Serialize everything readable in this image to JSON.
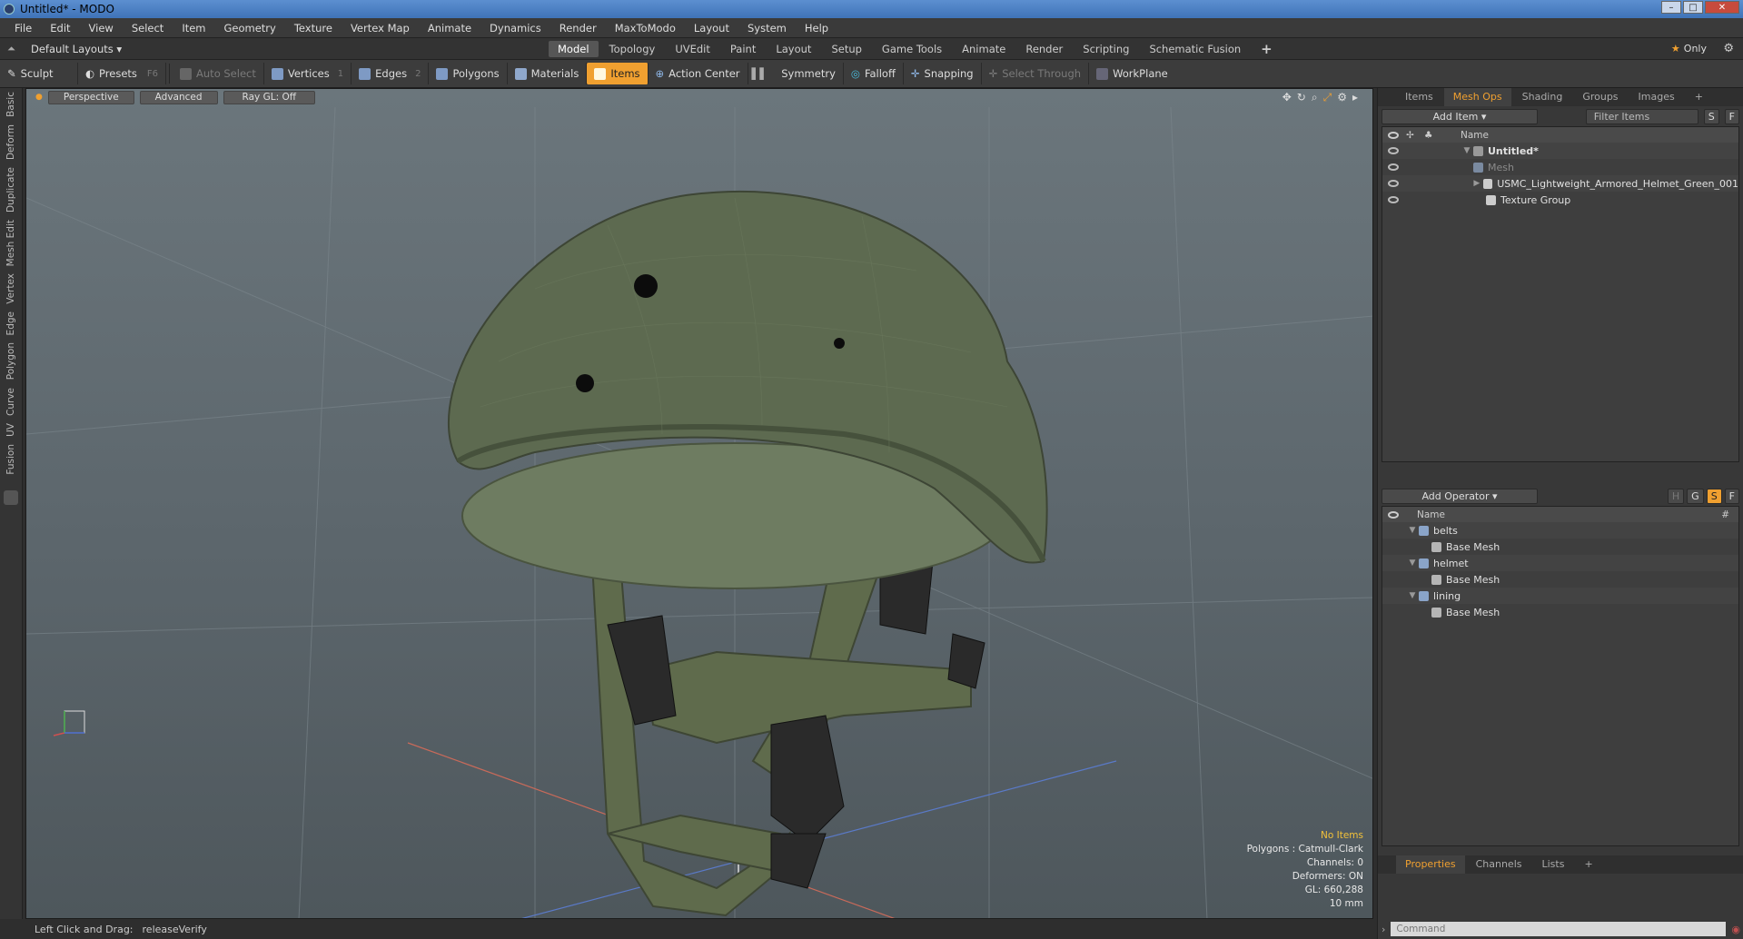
{
  "window": {
    "title": "Untitled* - MODO"
  },
  "menu": [
    "File",
    "Edit",
    "View",
    "Select",
    "Item",
    "Geometry",
    "Texture",
    "Vertex Map",
    "Animate",
    "Dynamics",
    "Render",
    "MaxToModo",
    "Layout",
    "System",
    "Help"
  ],
  "layout": {
    "preset": "Default Layouts",
    "tabs": [
      "Model",
      "Topology",
      "UVEdit",
      "Paint",
      "Layout",
      "Setup",
      "Game Tools",
      "Animate",
      "Render",
      "Scripting",
      "Schematic Fusion"
    ],
    "active_tab": "Model",
    "only_label": "Only"
  },
  "toolbar": {
    "sculpt": "Sculpt",
    "presets": "Presets",
    "presets_key": "F6",
    "auto_select": "Auto Select",
    "vertices": "Vertices",
    "vertices_count": "1",
    "edges": "Edges",
    "edges_count": "2",
    "polygons": "Polygons",
    "materials": "Materials",
    "items": "Items",
    "action_center": "Action Center",
    "symmetry": "Symmetry",
    "falloff": "Falloff",
    "snapping": "Snapping",
    "select_through": "Select Through",
    "workplane": "WorkPlane"
  },
  "left_tabs": [
    "Basic",
    "Deform",
    "Duplicate",
    "Mesh Edit",
    "Vertex",
    "Edge",
    "Polygon",
    "Curve",
    "UV",
    "Fusion"
  ],
  "viewport": {
    "view": "Perspective",
    "mode": "Advanced",
    "raygl": "Ray GL: Off",
    "info": {
      "selection": "No Items",
      "polygons": "Polygons : Catmull-Clark",
      "channels": "Channels: 0",
      "deformers": "Deformers: ON",
      "gl": "GL: 660,288",
      "grid": "10 mm"
    }
  },
  "status": {
    "hint": "Left Click and Drag:",
    "action": "releaseVerify"
  },
  "items_panel": {
    "tabs": [
      "Items",
      "Mesh Ops",
      "Shading",
      "Groups",
      "Images"
    ],
    "active_tab": "Mesh Ops",
    "add_item": "Add Item",
    "filter": "Filter Items",
    "name_header": "Name",
    "rows": [
      "Untitled*",
      "Mesh",
      "USMC_Lightweight_Armored_Helmet_Green_001",
      "Texture Group"
    ]
  },
  "meshops_panel": {
    "add_operator": "Add Operator",
    "name_header": "Name",
    "hash_header": "#",
    "rows": [
      "belts",
      "Base Mesh",
      "helmet",
      "Base Mesh",
      "lining",
      "Base Mesh"
    ]
  },
  "props_panel": {
    "tabs": [
      "Properties",
      "Channels",
      "Lists"
    ],
    "active_tab": "Properties",
    "command_placeholder": "Command"
  },
  "colors": {
    "accent": "#f0a030",
    "helmet": "#5d6a50",
    "strap": "#5f6b4c"
  }
}
